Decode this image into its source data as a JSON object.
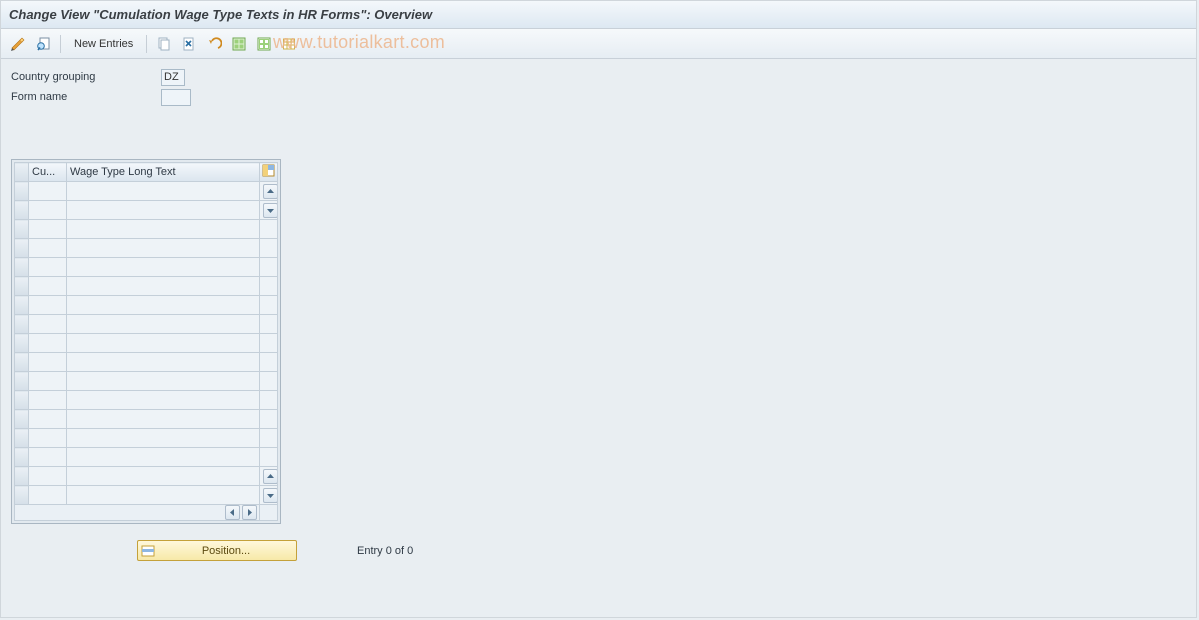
{
  "title": "Change View \"Cumulation Wage Type Texts in HR Forms\": Overview",
  "watermark": "www.tutorialkart.com",
  "toolbar": {
    "new_entries_label": "New Entries"
  },
  "form": {
    "country_grouping_label": "Country grouping",
    "country_grouping_value": "DZ",
    "form_name_label": "Form name",
    "form_name_value": ""
  },
  "table": {
    "columns": {
      "cu": "Cu...",
      "wage_text": "Wage Type Long Text"
    },
    "rows": [
      {
        "cu": "",
        "text": ""
      },
      {
        "cu": "",
        "text": ""
      },
      {
        "cu": "",
        "text": ""
      },
      {
        "cu": "",
        "text": ""
      },
      {
        "cu": "",
        "text": ""
      },
      {
        "cu": "",
        "text": ""
      },
      {
        "cu": "",
        "text": ""
      },
      {
        "cu": "",
        "text": ""
      },
      {
        "cu": "",
        "text": ""
      },
      {
        "cu": "",
        "text": ""
      },
      {
        "cu": "",
        "text": ""
      },
      {
        "cu": "",
        "text": ""
      },
      {
        "cu": "",
        "text": ""
      },
      {
        "cu": "",
        "text": ""
      },
      {
        "cu": "",
        "text": ""
      },
      {
        "cu": "",
        "text": ""
      },
      {
        "cu": "",
        "text": ""
      }
    ]
  },
  "footer": {
    "position_label": "Position...",
    "entry_text": "Entry 0 of 0"
  }
}
